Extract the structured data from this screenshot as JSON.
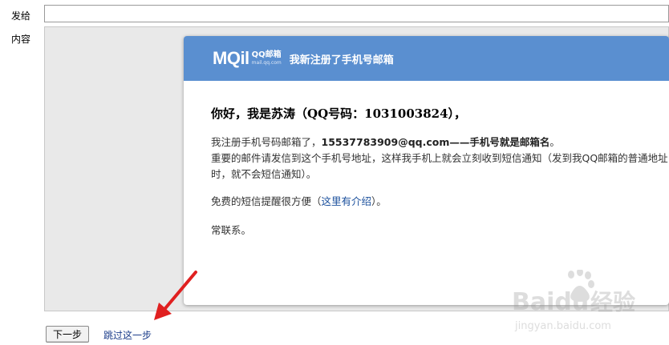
{
  "form": {
    "to_label": "发给",
    "to_value": "",
    "content_label": "内容"
  },
  "mail": {
    "logo_text": "MQil",
    "logo_brand": "QQ邮箱",
    "logo_domain": "mail.qq.com",
    "header_title": "我新注册了手机号邮箱",
    "greeting": "你好，我是苏涛（QQ号码：1031003824），",
    "p1_pre": "我注册手机号码邮箱了，",
    "p1_email": "15537783909@qq.com——手机号就是邮箱名",
    "p1_end": "。",
    "p2": "重要的邮件请发信到这个手机号地址，这样我手机上就会立刻收到短信通知（发到我QQ邮箱的普通地址时，就不会短信通知）。",
    "p3_pre": "免费的短信提醒很方便（",
    "p3_link": "这里有介绍",
    "p3_post": "）。",
    "p4": "常联系。"
  },
  "actions": {
    "next_label": "下一步",
    "skip_label": "跳过这一步"
  },
  "watermark": {
    "brand": "Baidu",
    "text": "经验",
    "url": "jingyan.baidu.com"
  },
  "colors": {
    "header_bg": "#5a8fd0",
    "arrow": "#e02020",
    "link": "#1a3c8a"
  }
}
